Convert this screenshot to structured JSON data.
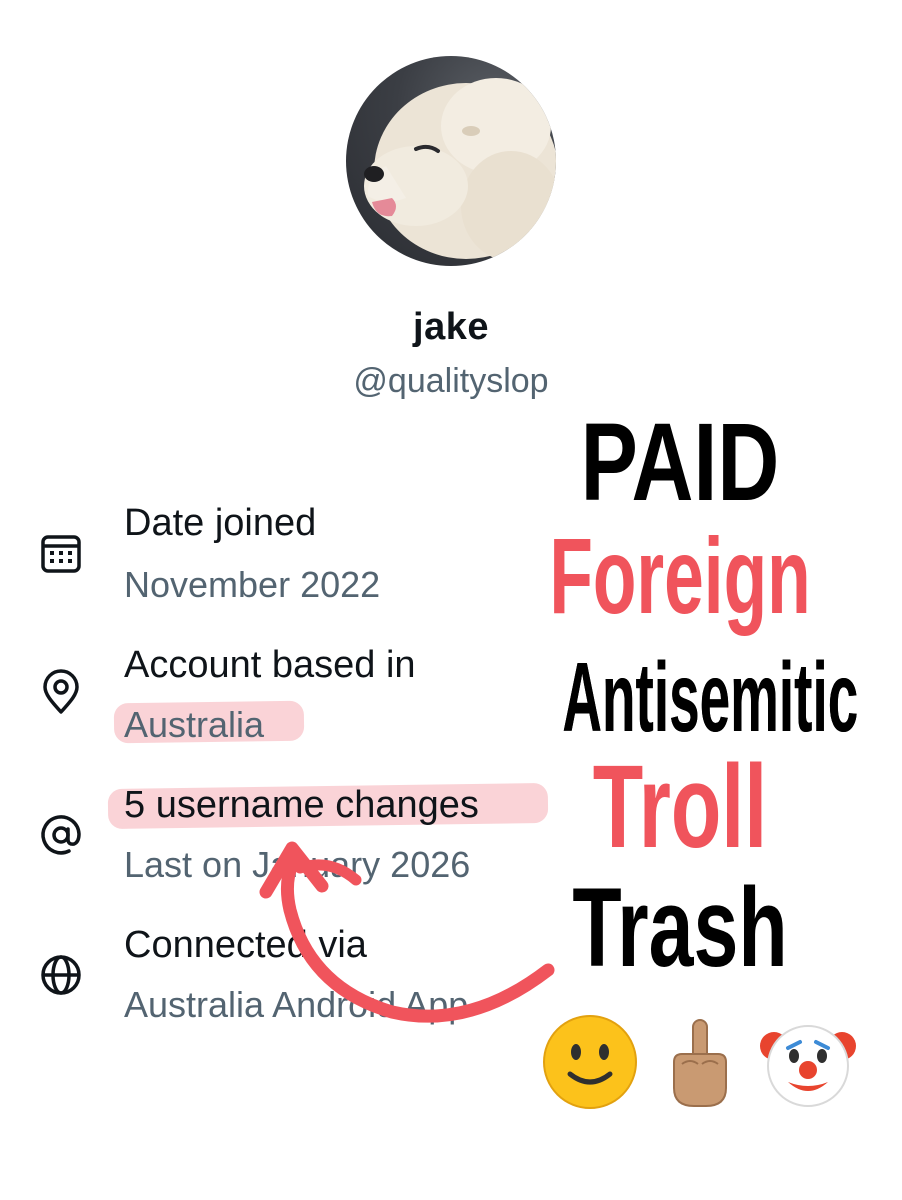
{
  "profile": {
    "display_name": "jake",
    "handle": "@qualityslop"
  },
  "rows": [
    {
      "icon": "calendar-icon",
      "title": "Date joined",
      "subtitle": "November 2022"
    },
    {
      "icon": "location-pin-icon",
      "title": "Account based in",
      "subtitle": "Australia"
    },
    {
      "icon": "at-sign-icon",
      "title": "5 username changes",
      "subtitle": "Last on January 2026"
    },
    {
      "icon": "globe-icon",
      "title": "Connected via",
      "subtitle": "Australia Android App"
    }
  ],
  "overlay": {
    "words": [
      "PAID",
      "Foreign",
      "Antisemitic",
      "Troll",
      "Trash"
    ],
    "emojis": [
      "slightly-smiling-face",
      "middle-finger",
      "clown-face"
    ],
    "red": "#f0545c",
    "highlight": "#f496a0"
  },
  "colors": {
    "primary_text": "#0f1419",
    "secondary_text": "#536471"
  }
}
